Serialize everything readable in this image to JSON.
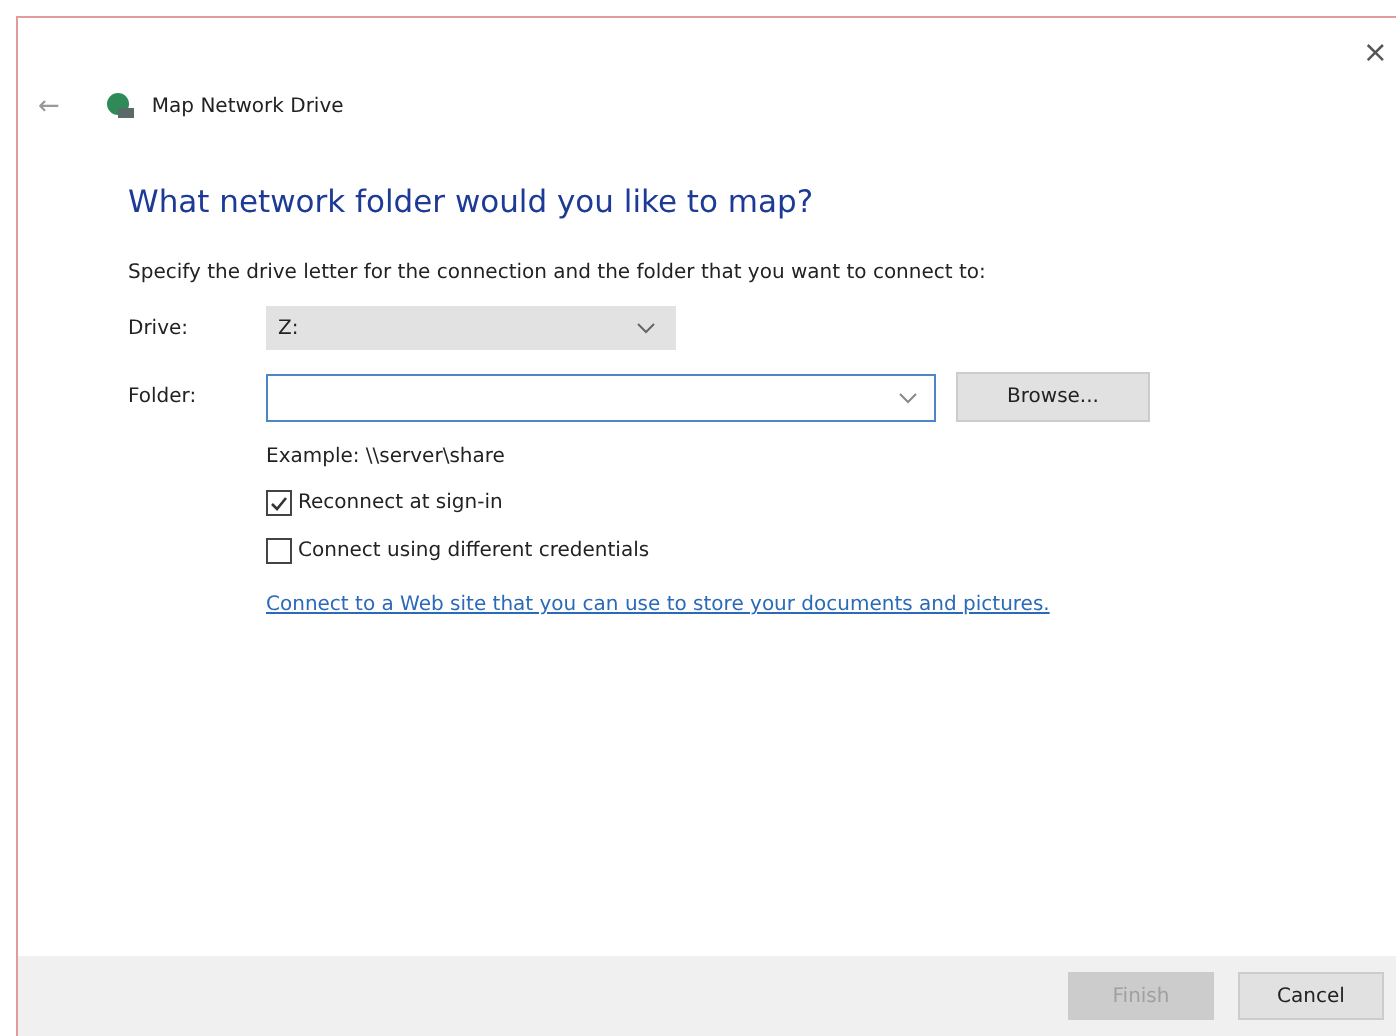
{
  "window": {
    "title": "Map Network Drive",
    "close": "×",
    "back": "←"
  },
  "heading": "What network folder would you like to map?",
  "description": "Specify the drive letter for the connection and the folder that you want to connect to:",
  "drive": {
    "label": "Drive:",
    "value": "Z:"
  },
  "folder": {
    "label": "Folder:"
  },
  "browse_button": "Browse...",
  "example": "Example: \\\\server\\share",
  "options": [
    {
      "label": "Reconnect at sign-in",
      "checked": true
    },
    {
      "label": "Connect using different credentials",
      "checked": false
    }
  ],
  "link": "Connect to a Web site that you can use to store your documents and pictures.",
  "buttons": [
    {
      "label": "Finish",
      "disabled": true
    },
    {
      "label": "Cancel",
      "disabled": false
    }
  ]
}
